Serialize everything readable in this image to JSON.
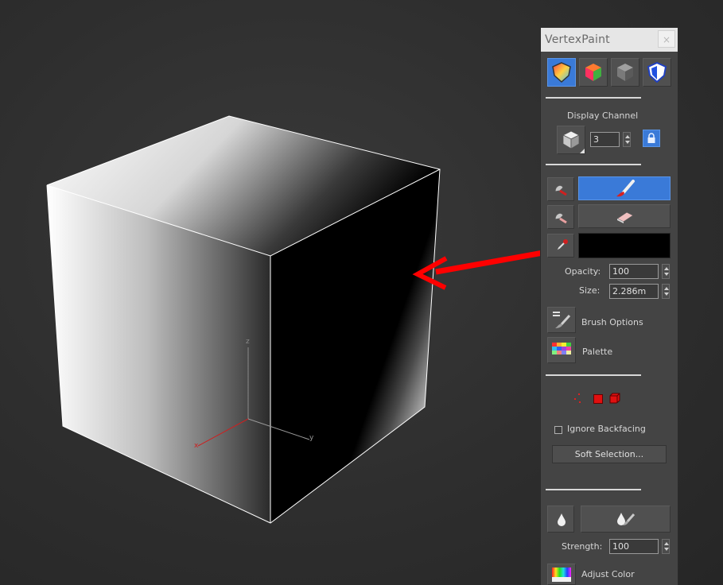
{
  "window": {
    "title": "VertexPaint",
    "close_label": "×"
  },
  "display_channel": {
    "label": "Display Channel",
    "value": "3"
  },
  "fields": {
    "opacity": {
      "label": "Opacity:",
      "value": "100"
    },
    "size": {
      "label": "Size:",
      "value": "2.286m"
    },
    "strength": {
      "label": "Strength:",
      "value": "100"
    }
  },
  "buttons": {
    "brush_options": "Brush Options",
    "palette": "Palette",
    "ignore_backfacing": "Ignore Backfacing",
    "soft_selection": "Soft Selection...",
    "adjust_color": "Adjust Color"
  },
  "viewport": {
    "axis_x": "x",
    "axis_y": "y",
    "axis_z": "z"
  },
  "colors": {
    "accent_blue": "#3a7ad8",
    "arrow_red": "#ff0000",
    "paint_color": "#000000"
  }
}
